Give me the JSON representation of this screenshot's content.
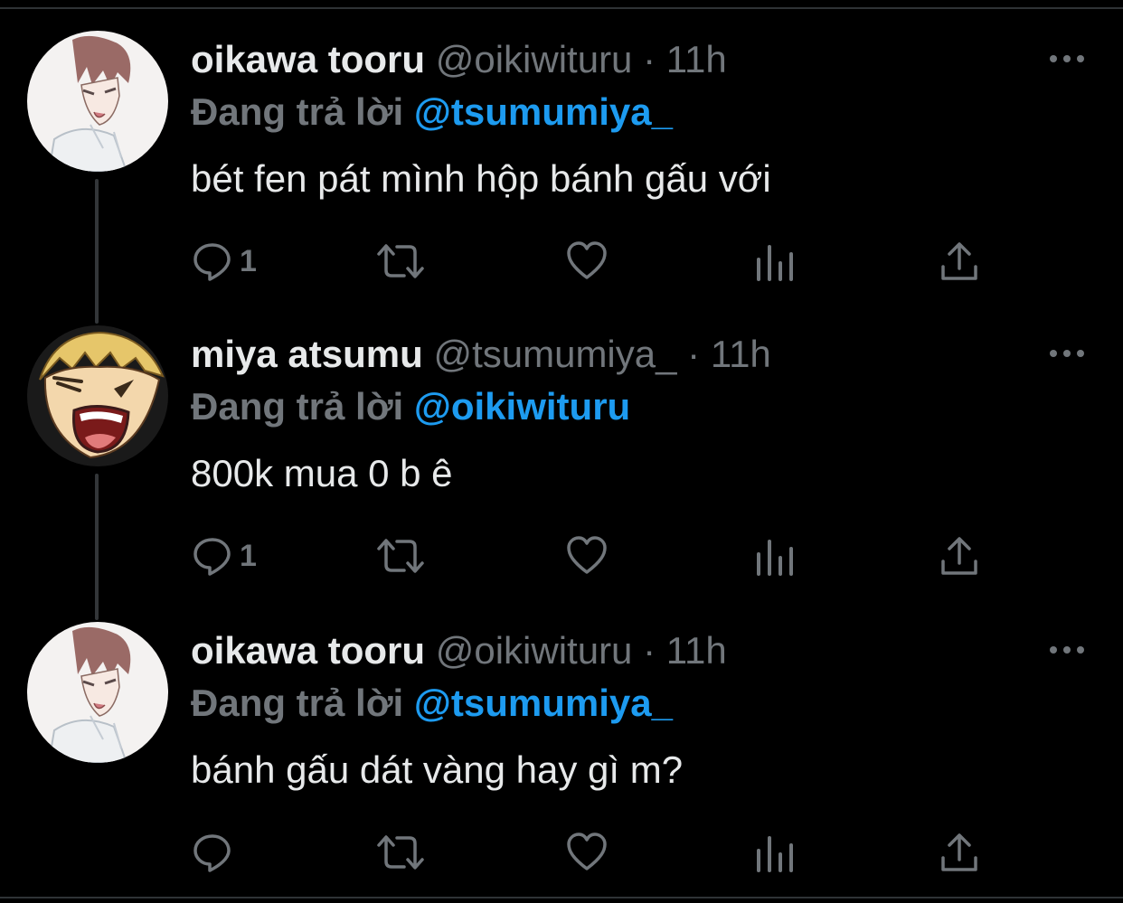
{
  "tweets": [
    {
      "name": "oikawa tooru",
      "handle": "@oikiwituru",
      "separator": "·",
      "time": "11h",
      "reply_prefix": "Đang trả lời",
      "reply_to": "@tsumumiya_",
      "text": "bét fen pát mình hộp bánh gấu với",
      "reply_count": "1",
      "avatar": "avatar-oikawa"
    },
    {
      "name": "miya atsumu",
      "handle": "@tsumumiya_",
      "separator": "·",
      "time": "11h",
      "reply_prefix": "Đang trả lời",
      "reply_to": "@oikiwituru",
      "text": "800k mua 0 b ê",
      "reply_count": "1",
      "avatar": "avatar-atsumu"
    },
    {
      "name": "oikawa tooru",
      "handle": "@oikiwituru",
      "separator": "·",
      "time": "11h",
      "reply_prefix": "Đang trả lời",
      "reply_to": "@tsumumiya_",
      "text": "bánh gấu dát vàng hay gì m?",
      "reply_count": "",
      "avatar": "avatar-oikawa"
    }
  ],
  "icons": {
    "reply": "reply-icon",
    "retweet": "retweet-icon",
    "like": "like-icon",
    "analytics": "analytics-icon",
    "share": "share-icon",
    "more": "more-icon"
  },
  "colors": {
    "background": "#000000",
    "name": "#e7e9ea",
    "muted": "#71767b",
    "mention": "#1d9bf0"
  }
}
